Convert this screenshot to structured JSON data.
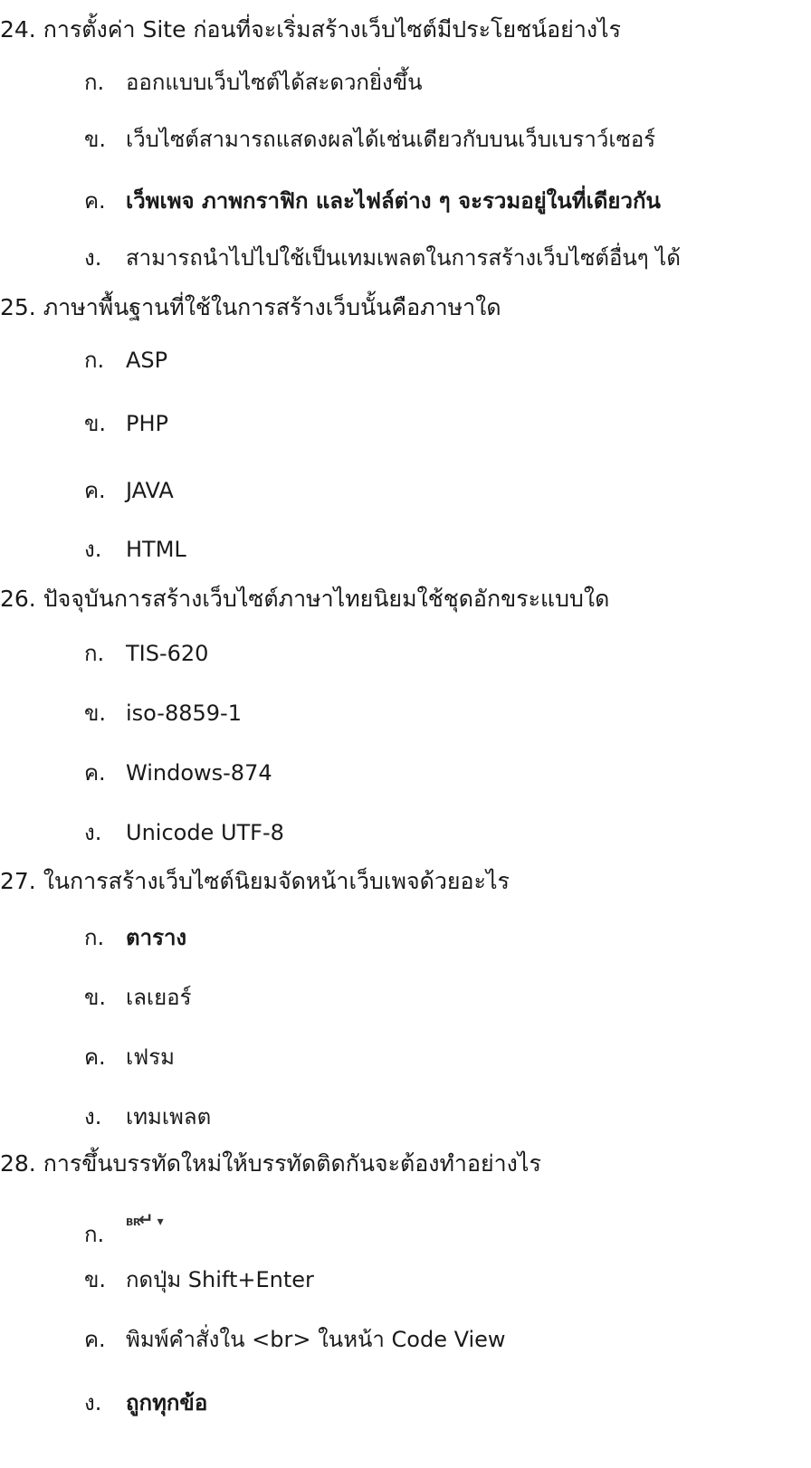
{
  "questions": [
    {
      "text": "24. การตั้งค่า Site ก่อนที่จะเริ่มสร้างเว็บไซต์มีประโยชน์อย่างไร",
      "options": [
        {
          "marker": "ก.",
          "text": "ออกแบบเว็บไซต์ได้สะดวกยิ่งขึ้น"
        },
        {
          "marker": "ข.",
          "text": "เว็บไซต์สามารถแสดงผลได้เช่นเดียวกับบนเว็บเบราว์เซอร์"
        },
        {
          "marker": "ค.",
          "text": "เว็พเพจ ภาพกราฟิก และไฟล์ต่าง ๆ จะรวมอยู่ในที่เดียวกัน"
        },
        {
          "marker": "ง.",
          "text": "สามารถนำไปไปใช้เป็นเทมเพลตในการสร้างเว็บไซต์อื่นๆ ได้"
        }
      ]
    },
    {
      "text": "25. ภาษาพื้นฐานที่ใช้ในการสร้างเว็บนั้นคือภาษาใด",
      "options": [
        {
          "marker": "ก.",
          "text": "ASP"
        },
        {
          "marker": "ข.",
          "text": "PHP"
        },
        {
          "marker": "ค.",
          "text": "JAVA"
        },
        {
          "marker": "ง.",
          "text": "HTML"
        }
      ]
    },
    {
      "text": "26. ปัจจุบันการสร้างเว็บไซต์ภาษาไทยนิยมใช้ชุดอักขระแบบใด",
      "options": [
        {
          "marker": "ก.",
          "text": "TIS-620"
        },
        {
          "marker": "ข.",
          "text": "iso-8859-1"
        },
        {
          "marker": "ค.",
          "text": "Windows-874"
        },
        {
          "marker": "ง.",
          "text": "Unicode UTF-8"
        }
      ]
    },
    {
      "text": "27. ในการสร้างเว็บไซต์นิยมจัดหน้าเว็บเพจด้วยอะไร",
      "options": [
        {
          "marker": "ก.",
          "text": "ตาราง"
        },
        {
          "marker": "ข.",
          "text": "เลเยอร์"
        },
        {
          "marker": "ค.",
          "text": "เฟรม"
        },
        {
          "marker": "ง.",
          "text": "เทมเพลต"
        }
      ]
    },
    {
      "text": "28. การขึ้นบรรทัดใหม่ให้บรรทัดติดกันจะต้องทำอย่างไร",
      "options": [
        {
          "marker": "ก.",
          "icon": "line-break-br-icon",
          "icon_text": "BR"
        },
        {
          "marker": "ข.",
          "text": "กดปุ่ม Shift+Enter"
        },
        {
          "marker": "ค.",
          "text": "พิมพ์คำสั่งใน <br> ในหน้า Code View"
        },
        {
          "marker": "ง.",
          "text": "ถูกทุกข้อ"
        }
      ]
    }
  ]
}
